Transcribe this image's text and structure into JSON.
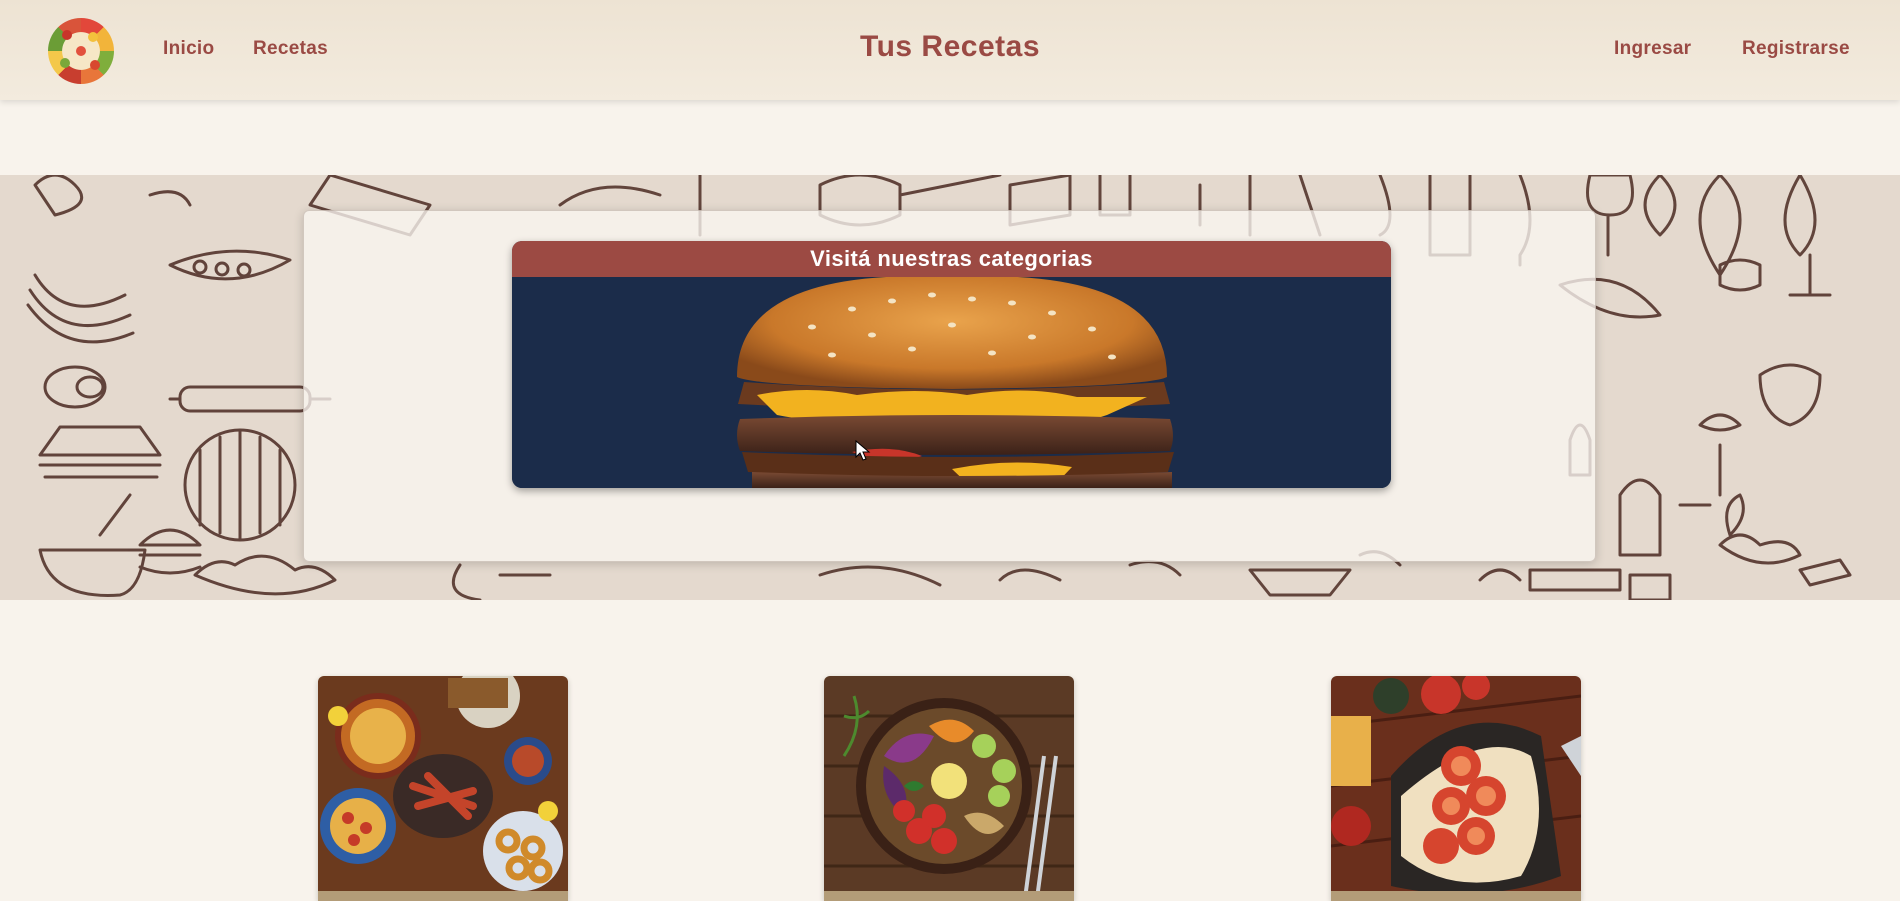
{
  "navbar": {
    "logo_icon": "food-wheel-logo",
    "links": [
      "Inicio",
      "Recetas"
    ],
    "brand": "Tus Recetas",
    "auth": [
      "Ingresar",
      "Registrarse"
    ]
  },
  "hero": {
    "carousel_title": "Visitá nuestras categorias",
    "slide_image": "burger-image"
  },
  "categories": [
    {
      "image": "traditional-dishes-image"
    },
    {
      "image": "salad-bowl-image"
    },
    {
      "image": "pizza-bread-image"
    }
  ],
  "colors": {
    "accent": "#9a4a44",
    "banner": "#9c4a43",
    "nav_bg": "#ede3d3",
    "page_bg": "#f8f3ec",
    "doodle_band": "#e4d9ce",
    "card_caption": "#b39c78"
  }
}
